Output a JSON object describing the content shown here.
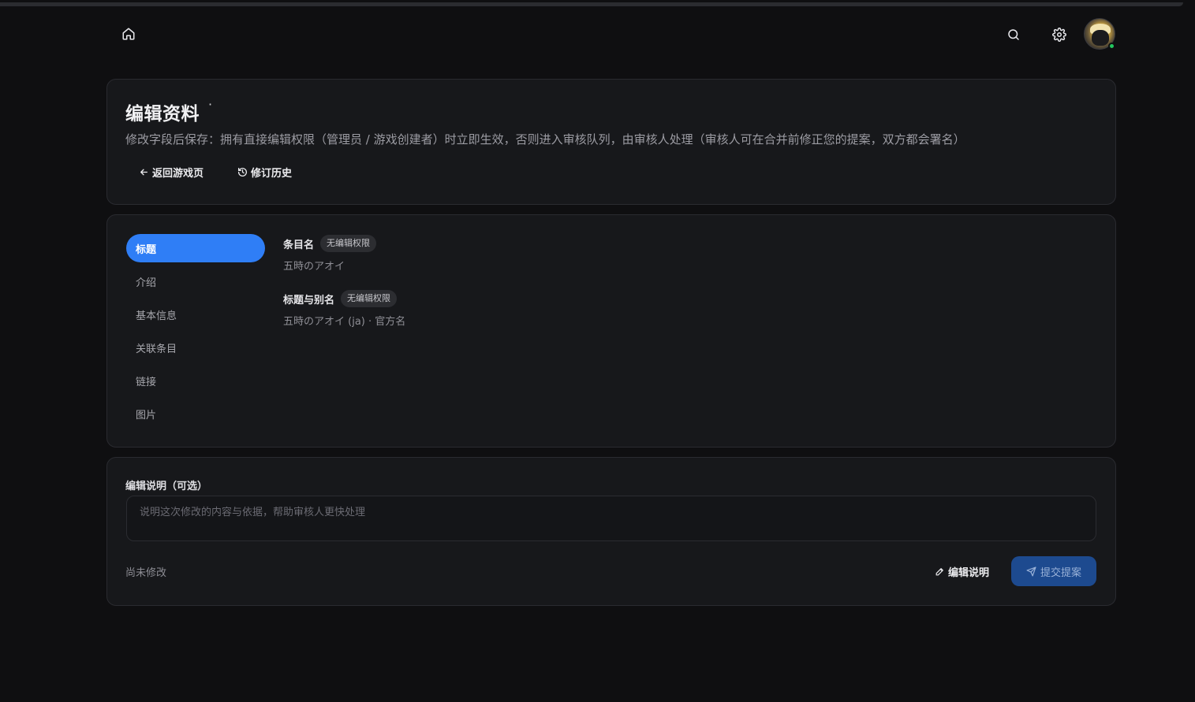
{
  "colors": {
    "background": "#0f0f11",
    "card": "#17181b",
    "accent": "#2f7ef6",
    "submit_bg": "#1d4a8f",
    "online": "#22c55e"
  },
  "topbar": {
    "home_icon": "home-icon",
    "search_icon": "search-icon",
    "settings_icon": "gear-icon"
  },
  "header": {
    "title": "编辑资料",
    "title_dot": "·",
    "description": "修改字段后保存：拥有直接编辑权限（管理员 / 游戏创建者）时立即生效，否则进入审核队列，由审核人处理（审核人可在合并前修正您的提案，双方都会署名）",
    "back_label": "返回游戏页",
    "history_label": "修订历史"
  },
  "sidebar": {
    "items": [
      {
        "label": "标题",
        "active": true
      },
      {
        "label": "介绍"
      },
      {
        "label": "基本信息"
      },
      {
        "label": "关联条目"
      },
      {
        "label": "链接"
      },
      {
        "label": "图片"
      }
    ]
  },
  "fields": [
    {
      "label": "条目名",
      "badge": "无编辑权限",
      "value": "五時のアオイ"
    },
    {
      "label": "标题与别名",
      "badge": "无编辑权限",
      "value": "五時のアオイ (ja) · 官方名"
    }
  ],
  "note": {
    "label": "编辑说明（可选）",
    "placeholder": "说明这次修改的内容与依据，帮助审核人更快处理",
    "value": "",
    "status": "尚未修改",
    "edit_label": "编辑说明",
    "submit_label": "提交提案"
  }
}
